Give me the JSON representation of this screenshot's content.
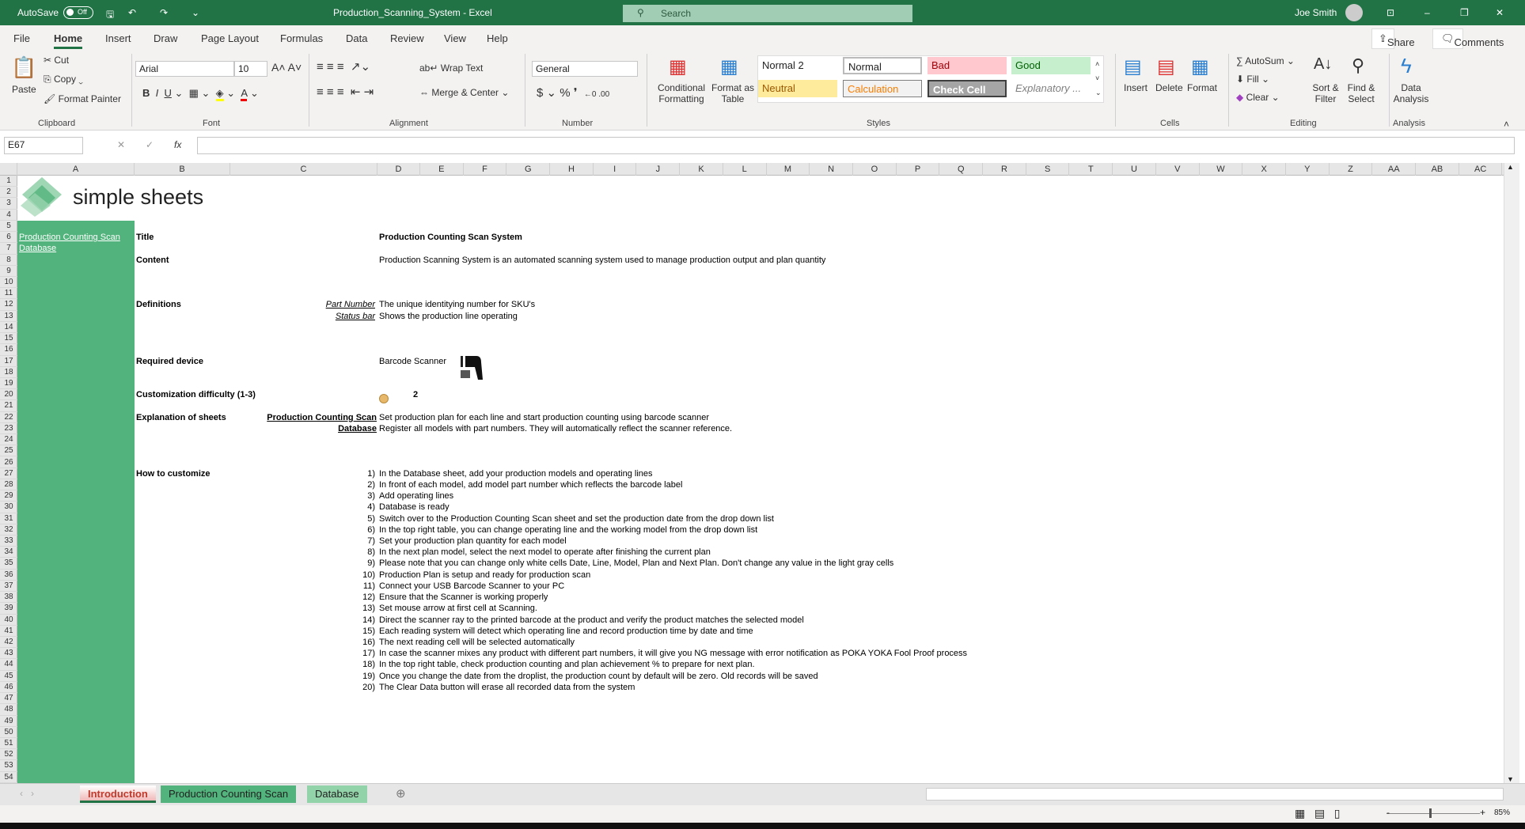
{
  "titlebar": {
    "autosave": "AutoSave",
    "autosave_state": "Off",
    "title": "Production_Scanning_System - Excel",
    "search": "Search",
    "user": "Joe Smith"
  },
  "tabs": [
    "File",
    "Home",
    "Insert",
    "Draw",
    "Page Layout",
    "Formulas",
    "Data",
    "Review",
    "View",
    "Help"
  ],
  "share": "Share",
  "comments": "Comments",
  "ribbon": {
    "clipboard": {
      "paste": "Paste",
      "cut": "Cut",
      "copy": "Copy",
      "format_painter": "Format Painter",
      "label": "Clipboard"
    },
    "font": {
      "name": "Arial",
      "size": "10",
      "label": "Font"
    },
    "alignment": {
      "wrap": "Wrap Text",
      "merge": "Merge & Center",
      "label": "Alignment"
    },
    "number": {
      "format": "General",
      "label": "Number"
    },
    "styles": {
      "conditional": "Conditional Formatting",
      "format_table": "Format as Table",
      "cells": [
        "Normal 2",
        "Normal",
        "Bad",
        "Good",
        "Neutral",
        "Calculation",
        "Check Cell",
        "Explanatory ..."
      ],
      "label": "Styles"
    },
    "cells": {
      "insert": "Insert",
      "delete": "Delete",
      "format": "Format",
      "label": "Cells"
    },
    "editing": {
      "autosum": "AutoSum",
      "fill": "Fill",
      "clear": "Clear",
      "sort": "Sort & Filter",
      "find": "Find & Select",
      "label": "Editing"
    },
    "analysis": {
      "data_analysis": "Data Analysis",
      "label": "Analysis"
    }
  },
  "formula_bar": {
    "name_box": "E67",
    "fx": "fx",
    "value": ""
  },
  "columns": [
    "A",
    "B",
    "C",
    "D",
    "E",
    "F",
    "G",
    "H",
    "I",
    "J",
    "K",
    "L",
    "M",
    "N",
    "O",
    "P",
    "Q",
    "R",
    "S",
    "T",
    "U",
    "V",
    "W",
    "X",
    "Y",
    "Z",
    "AA",
    "AB",
    "AC"
  ],
  "sheet": {
    "logo": "simple sheets",
    "nav": [
      "Production Counting Scan",
      "Database"
    ],
    "title_label": "Title",
    "title_value": "Production Counting Scan System",
    "content_label": "Content",
    "content_value": "Production Scanning System is an automated scanning system used to manage production output and plan quantity",
    "definitions_label": "Definitions",
    "definitions": [
      {
        "term": "Part Number",
        "text": "The unique identitying number for SKU's"
      },
      {
        "term": "Status bar",
        "text": "Shows the production line operating"
      }
    ],
    "device_label": "Required device",
    "device_value": "Barcode Scanner",
    "difficulty_label": "Customization difficulty (1-3)",
    "difficulty_value": "2",
    "explanation_label": "Explanation of sheets",
    "explanations": [
      {
        "sheet": "Production Counting Scan",
        "text": "Set production plan for each line and start production counting using barcode scanner"
      },
      {
        "sheet": "Database",
        "text": "Register all models with part numbers. They will automatically reflect the scanner reference."
      }
    ],
    "customize_label": "How to customize",
    "steps": [
      {
        "n": "1)",
        "t": "In the Database sheet, add your production models and operating lines"
      },
      {
        "n": "2)",
        "t": "In front of each model, add model part number which reflects the barcode label"
      },
      {
        "n": "3)",
        "t": "Add operating lines"
      },
      {
        "n": "4)",
        "t": "Database is ready"
      },
      {
        "n": "5)",
        "t": "Switch over to the Production Counting Scan sheet and set the production date from the drop down list"
      },
      {
        "n": "6)",
        "t": "In the top right table, you can change operating line and the working model from the drop down list"
      },
      {
        "n": "7)",
        "t": "Set your production plan quantity for each model"
      },
      {
        "n": "8)",
        "t": "In the next plan model, select the next model to operate after finishing the current plan"
      },
      {
        "n": "9)",
        "t": "Please note that you can change only white cells Date, Line, Model, Plan and Next Plan. Don't change any value in the light gray cells"
      },
      {
        "n": "10)",
        "t": "Production Plan is setup and ready for production scan"
      },
      {
        "n": "11)",
        "t": "Connect your USB Barcode Scanner to your PC"
      },
      {
        "n": "12)",
        "t": "Ensure that the Scanner is working properly"
      },
      {
        "n": "13)",
        "t": "Set mouse arrow at first cell at Scanning."
      },
      {
        "n": "14)",
        "t": "Direct the scanner ray to the printed barcode at the product and verify the product matches the selected model"
      },
      {
        "n": "15)",
        "t": "Each reading system will detect which operating line and record production time by date and time"
      },
      {
        "n": "16)",
        "t": "The next reading cell will be selected automatically"
      },
      {
        "n": "17)",
        "t": "In case the scanner mixes any product with different part numbers, it will give you NG message with error notification as POKA YOKA Fool Proof process"
      },
      {
        "n": "18)",
        "t": "In the top right table, check production counting and plan achievement % to prepare for next plan."
      },
      {
        "n": "19)",
        "t": "Once you change the date from the droplist, the production count by default will be zero. Old records will be saved"
      },
      {
        "n": "20)",
        "t": "The Clear Data button will erase all recorded data from the system"
      }
    ]
  },
  "sheet_tabs": [
    "Introduction",
    "Production Counting Scan",
    "Database"
  ],
  "status": {
    "zoom": "85%"
  },
  "colors": {
    "excel_green": "#217346",
    "sheet_green": "#52b47c",
    "difficulty_dot": "#e8b86a"
  }
}
